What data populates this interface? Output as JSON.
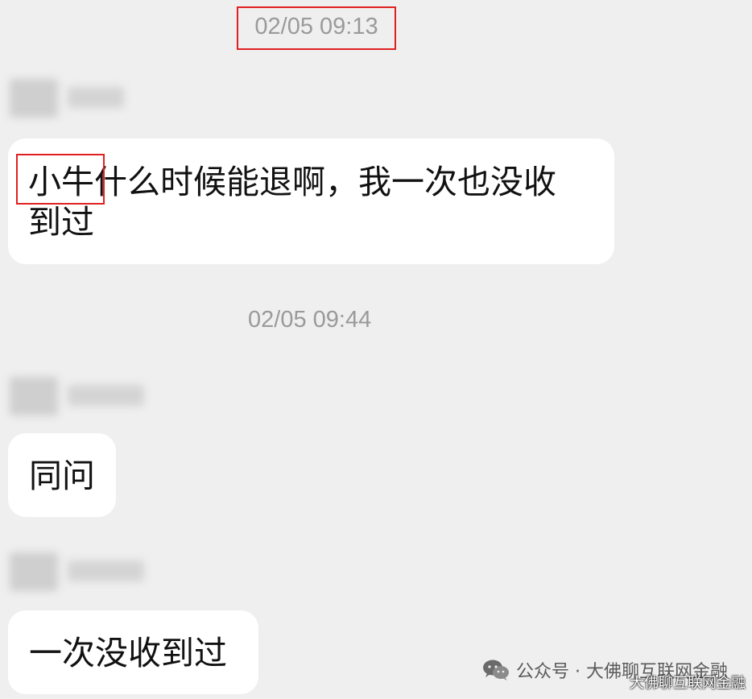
{
  "timestamps": [
    "02/05 09:13",
    "02/05 09:44"
  ],
  "messages": [
    {
      "text_highlighted": "小牛",
      "text_rest": "什么时候能退啊，我一次也没收",
      "text_line2": "到过"
    },
    {
      "text": "同问"
    },
    {
      "text": "一次没收到过"
    }
  ],
  "watermark": {
    "text": "公众号 · 大佛聊互联网金融",
    "corner": "大佛聊互联网金融"
  }
}
